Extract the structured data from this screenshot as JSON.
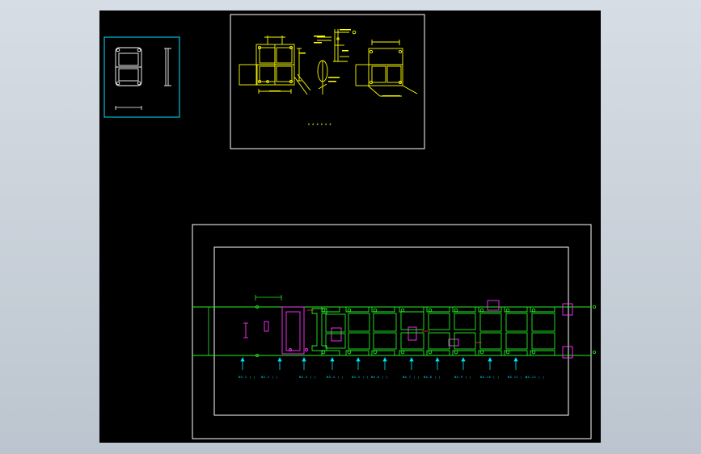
{
  "colors": {
    "background_top": "#d7dde4",
    "background_bottom": "#bcc5cf",
    "canvas": "#000000",
    "frame": "#ffffff",
    "cyan": "#00e5ff",
    "yellow": "#ffff00",
    "green": "#22ee22",
    "magenta": "#ff33ff",
    "red": "#ff3333"
  },
  "layout_sheet": {
    "caption": "# # # # # #"
  },
  "station_labels": [
    "NO.1 ( )",
    "NO.2 ( )",
    "NO.3 ( )",
    "NO.4 ( )",
    "NO.5 ( )",
    "NO.6 ( )",
    "NO.7 ( )",
    "NO.8 ( )",
    "NO.9 ( )",
    "NO.10 ( )",
    "NO.11 ( )",
    "NO.12 ( )"
  ]
}
